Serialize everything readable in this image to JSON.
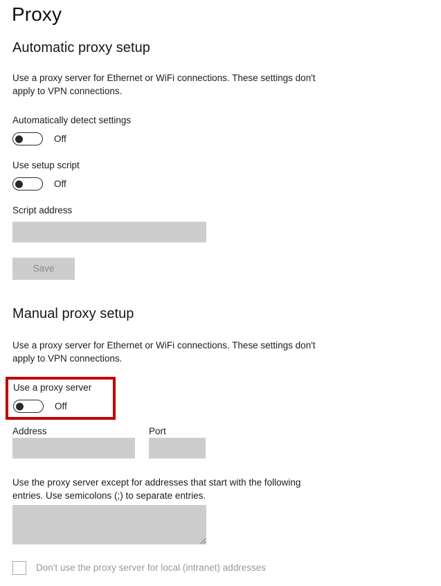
{
  "page": {
    "title": "Proxy"
  },
  "automatic_section": {
    "heading": "Automatic proxy setup",
    "description": "Use a proxy server for Ethernet or WiFi connections. These settings don't apply to VPN connections.",
    "auto_detect": {
      "label": "Automatically detect settings",
      "state": "Off"
    },
    "setup_script": {
      "label": "Use setup script",
      "state": "Off"
    },
    "script_address": {
      "label": "Script address",
      "value": "",
      "placeholder": ""
    },
    "save_button": {
      "label": "Save"
    }
  },
  "manual_section": {
    "heading": "Manual proxy setup",
    "description": "Use a proxy server for Ethernet or WiFi connections. These settings don't apply to VPN connections.",
    "use_proxy": {
      "label": "Use a proxy server",
      "state": "Off"
    },
    "address": {
      "label": "Address",
      "value": "",
      "placeholder": ""
    },
    "port": {
      "label": "Port",
      "value": "",
      "placeholder": ""
    },
    "exceptions": {
      "description": "Use the proxy server except for addresses that start with the following entries. Use semicolons (;) to separate entries.",
      "value": "",
      "placeholder": ""
    },
    "local_bypass": {
      "label": "Don't use the proxy server for local (intranet) addresses",
      "checked": false
    }
  },
  "annotation": {
    "color": "#C00000",
    "target": "use-a-proxy-server-toggle"
  }
}
